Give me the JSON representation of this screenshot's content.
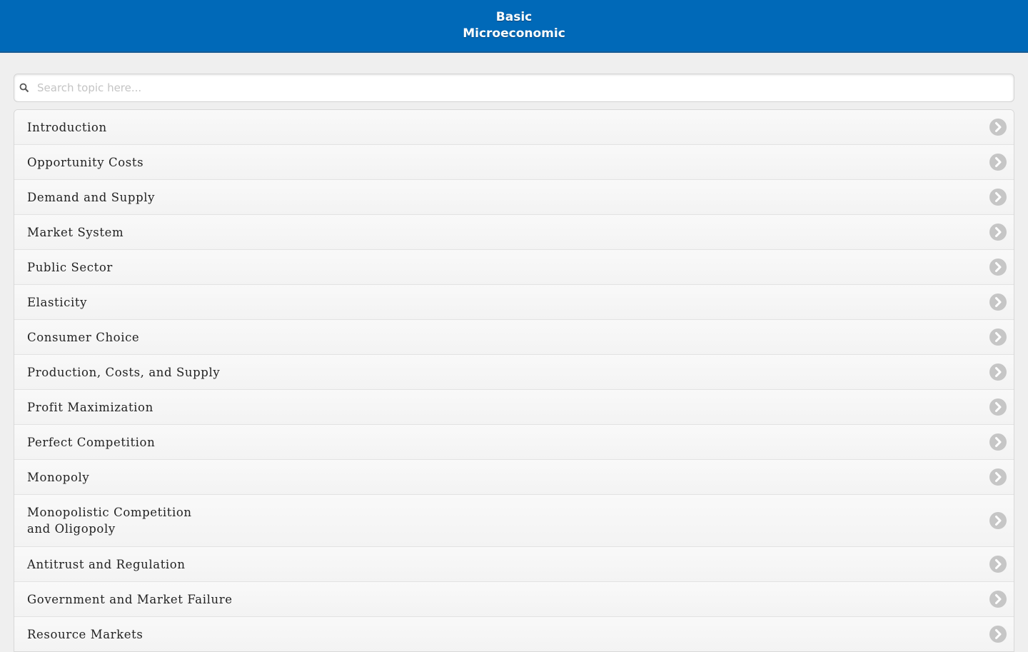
{
  "header": {
    "title_line1": "Basic",
    "title_line2": "Microeconomic"
  },
  "search": {
    "placeholder": "Search topic here...",
    "value": "",
    "icon": "search-icon"
  },
  "topics": [
    {
      "label": "Introduction"
    },
    {
      "label": "Opportunity Costs"
    },
    {
      "label": "Demand and Supply"
    },
    {
      "label": "Market System"
    },
    {
      "label": "Public Sector"
    },
    {
      "label": "Elasticity"
    },
    {
      "label": "Consumer Choice"
    },
    {
      "label": "Production, Costs, and Supply"
    },
    {
      "label": "Profit Maximization"
    },
    {
      "label": "Perfect Competition"
    },
    {
      "label": "Monopoly"
    },
    {
      "label": "Monopolistic Competition\nand Oligopoly"
    },
    {
      "label": "Antitrust and Regulation"
    },
    {
      "label": "Government and Market Failure"
    },
    {
      "label": "Resource Markets"
    }
  ],
  "colors": {
    "header_bg": "#0069b8",
    "page_bg": "#efefef",
    "arrow_icon": "#c6c6c6"
  },
  "icons": {
    "row_arrow": "chevron-right-circle-icon"
  }
}
